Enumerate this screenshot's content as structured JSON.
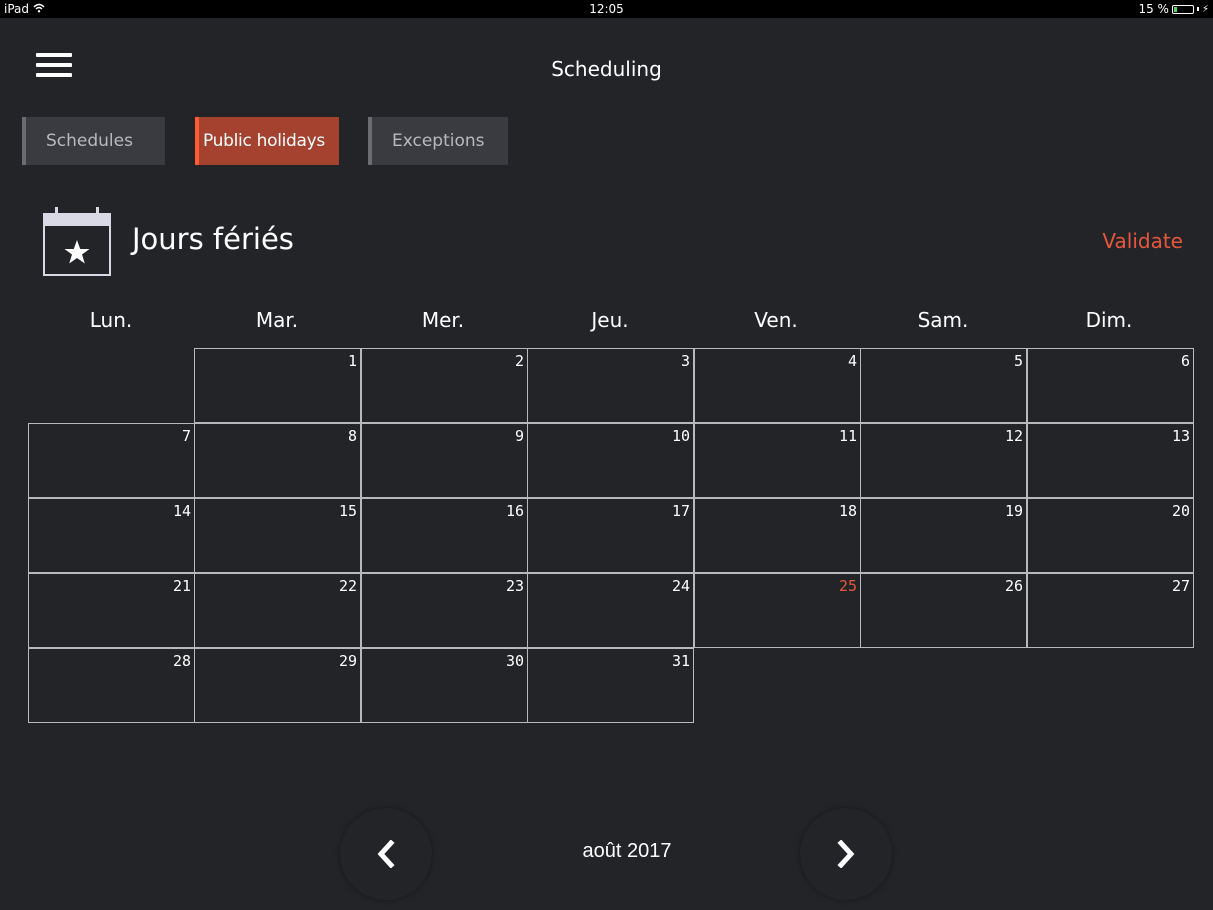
{
  "status_bar": {
    "device": "iPad",
    "time": "12:05",
    "battery": "15 %",
    "battery_level": 0.15,
    "wifi_icon": "wifi-icon",
    "charging_icon": "bolt-icon"
  },
  "header": {
    "title": "Scheduling",
    "menu_icon": "hamburger-menu-icon"
  },
  "tabs": [
    {
      "label": "Schedules",
      "active": false
    },
    {
      "label": "Public holidays",
      "active": true
    },
    {
      "label": "Exceptions",
      "active": false
    }
  ],
  "section": {
    "icon": "calendar-star-icon",
    "title": "Jours fériés",
    "validate_label": "Validate"
  },
  "calendar": {
    "weekdays": [
      "Lun.",
      "Mar.",
      "Mer.",
      "Jeu.",
      "Ven.",
      "Sam.",
      "Dim."
    ],
    "weeks": [
      [
        null,
        "1",
        "2",
        "3",
        "4",
        "5",
        "6"
      ],
      [
        "7",
        "8",
        "9",
        "10",
        "11",
        "12",
        "13"
      ],
      [
        "14",
        "15",
        "16",
        "17",
        "18",
        "19",
        "20"
      ],
      [
        "21",
        "22",
        "23",
        "24",
        "25",
        "26",
        "27"
      ],
      [
        "28",
        "29",
        "30",
        "31",
        null,
        null,
        null
      ]
    ],
    "highlighted_days": [
      "25"
    ],
    "month_label": "août 2017",
    "prev_icon": "chevron-left-icon",
    "next_icon": "chevron-right-icon"
  },
  "colors": {
    "accent": "#e8573d",
    "background": "#232428",
    "active_tab": "#a5412f"
  }
}
